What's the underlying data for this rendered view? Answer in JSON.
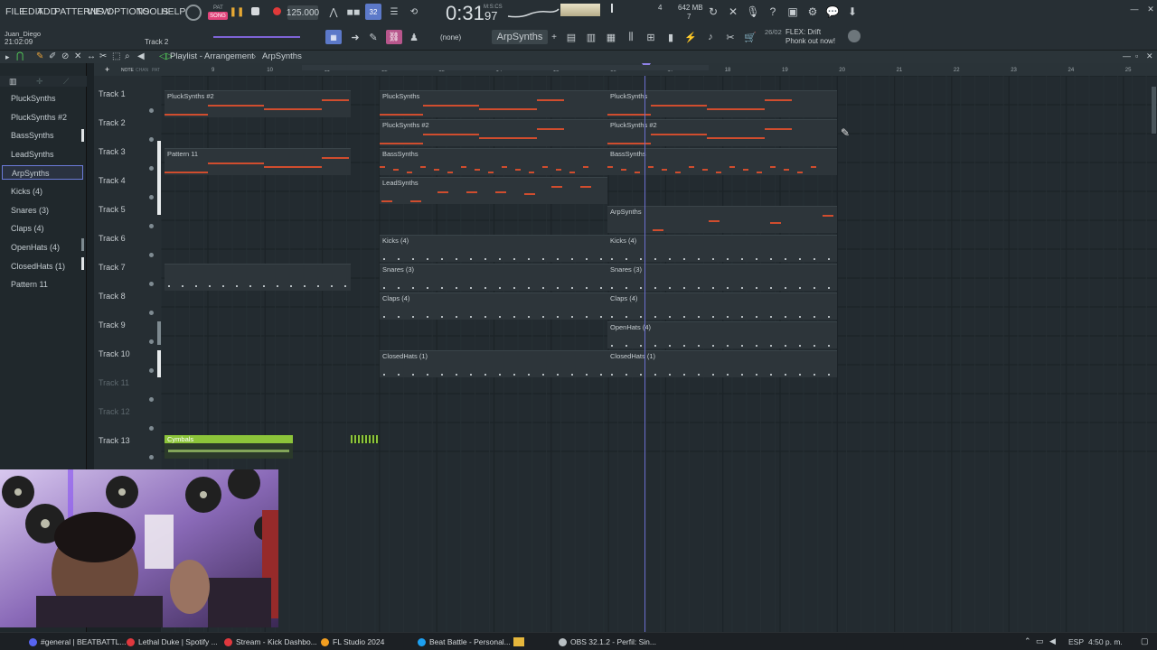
{
  "menu": [
    "FILE",
    "EDIT",
    "ADD",
    "PATTERNS",
    "VIEW",
    "OPTIONS",
    "TOOLS",
    "HELP"
  ],
  "transport": {
    "mode_label": "PAT",
    "song_label": "SONG",
    "tempo": "125.000",
    "time": "0:31",
    "time_sub": "97",
    "time_unit": "M:S:CS",
    "cpu": "4",
    "memory": "642 MB",
    "polyphony": "7"
  },
  "user": {
    "name": "Juan_Diego",
    "clock": "21:02:09",
    "current_track": "Track 2"
  },
  "toolbar": {
    "channel_filter": "(none)",
    "pattern_name": "ArpSynths"
  },
  "news": {
    "date": "26/02",
    "text": "FLEX: Drift Phonk out now!"
  },
  "playlist": {
    "title": "Playlist - Arrangement",
    "pattern": "ArpSynths",
    "header_small": [
      "NOTE",
      "CHAN",
      "PAT"
    ]
  },
  "channels": [
    "PluckSynths",
    "PluckSynths #2",
    "BassSynths",
    "LeadSynths",
    "ArpSynths",
    "Kicks (4)",
    "Snares (3)",
    "Claps (4)",
    "OpenHats (4)",
    "ClosedHats (1)",
    "Pattern 11"
  ],
  "tracks": [
    "Track 1",
    "Track 2",
    "Track 3",
    "Track 4",
    "Track 5",
    "Track 6",
    "Track 7",
    "Track 8",
    "Track 9",
    "Track 10",
    "Track 11",
    "Track 12",
    "Track 13"
  ],
  "bars": [
    "9",
    "10",
    "11",
    "12",
    "13",
    "14",
    "15",
    "16",
    "17",
    "18",
    "19",
    "20",
    "21",
    "22",
    "23",
    "24",
    "25",
    "26"
  ],
  "clips": {
    "t1a": "PluckSynths #2",
    "t1b": "PluckSynths",
    "t1c": "PluckSynths",
    "t2b": "PluckSynths #2",
    "t2c": "PluckSynths #2",
    "t3a": "Pattern 11",
    "t3b": "BassSynths",
    "t3c": "BassSynths",
    "t4b": "LeadSynths",
    "t5c": "ArpSynths",
    "t6b": "Kicks (4)",
    "t6c": "Kicks (4)",
    "t7b": "Snares (3)",
    "t7c": "Snares (3)",
    "t8b": "Claps (4)",
    "t8c": "Claps (4)",
    "t9c": "OpenHats (4)",
    "t10b": "ClosedHats (1)",
    "t10c": "ClosedHats (1)",
    "t13a": "Cymbals"
  },
  "taskbar": [
    {
      "label": "#general | BEATBATTL...",
      "color": "#5865f2"
    },
    {
      "label": "Lethal Duke | Spotify ...",
      "color": "#e0383e"
    },
    {
      "label": "Stream - Kick Dashbo...",
      "color": "#e0383e"
    },
    {
      "label": "FL Studio 2024",
      "color": "#f29e20"
    },
    {
      "label": "Beat Battle - Personal...",
      "color": "#1da1f2"
    },
    {
      "label": "OBS 32.1.2 - Perfil: Sin...",
      "color": "#b9c0c4"
    }
  ],
  "tray": {
    "lang": "ESP",
    "time": "4:50 p. m."
  },
  "colors": {
    "note": "#d04d2e",
    "cymbal_clip": "#8cc43a",
    "accent_blue": "#3b6fd6"
  }
}
